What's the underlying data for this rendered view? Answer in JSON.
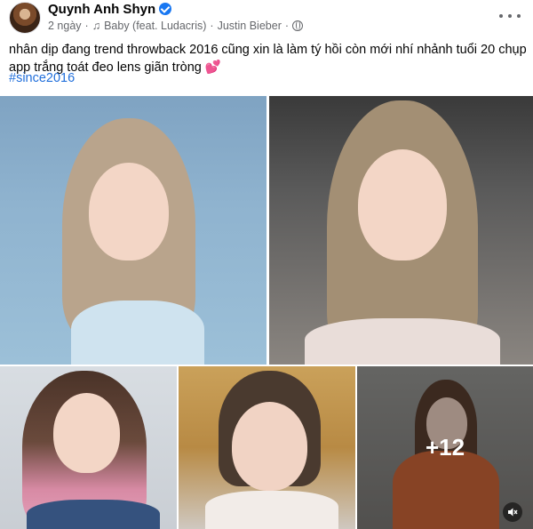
{
  "post": {
    "author": "Quynh Anh Shyn",
    "time": "2 ngày",
    "separator": "·",
    "song": "Baby (feat. Ludacris)",
    "artist": "Justin Bieber",
    "caption": "nhân dịp đang trend throwback 2016 cũng xin là làm tý hồi còn mới nhí nhảnh tuổi 20 chụp app trắng toát đeo lens giãn tròng",
    "caption_emoji": "💕",
    "hashtag": "#since2016"
  },
  "gallery": {
    "more_count": "+12"
  },
  "icons": {
    "verified": "verified-badge-icon",
    "music": "music-note-icon",
    "privacy": "globe-icon",
    "more": "more-options-icon",
    "mute": "speaker-mute-icon"
  },
  "colors": {
    "link": "#216fdb",
    "verified": "#1877f2",
    "meta_text": "#65676b"
  }
}
